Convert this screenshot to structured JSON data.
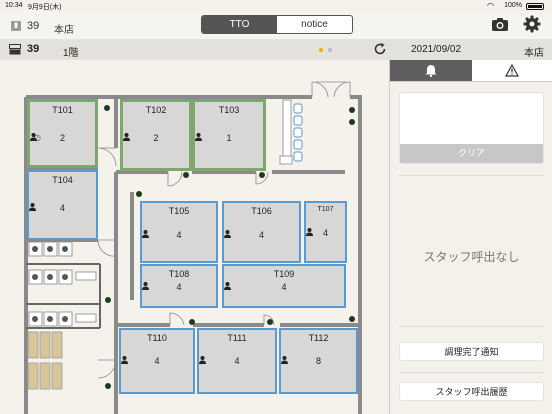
{
  "status": {
    "time": "10:34",
    "date": "9月9日(木)",
    "battery": "100%"
  },
  "header": {
    "badge": "39",
    "store": "本店",
    "tabs": [
      {
        "label": "TTO"
      },
      {
        "label": "notice"
      }
    ]
  },
  "subheader": {
    "register_count": "39",
    "floor": "1階",
    "date": "2021/09/02",
    "store": "本店"
  },
  "tables": [
    {
      "id": "T101",
      "count": "2"
    },
    {
      "id": "T102",
      "count": "2"
    },
    {
      "id": "T103",
      "count": "1"
    },
    {
      "id": "T104",
      "count": "4"
    },
    {
      "id": "T105",
      "count": "4"
    },
    {
      "id": "T106",
      "count": "4"
    },
    {
      "id": "T107",
      "count": "4"
    },
    {
      "id": "T108",
      "count": "4"
    },
    {
      "id": "T109",
      "count": "4"
    },
    {
      "id": "T110",
      "count": "4"
    },
    {
      "id": "T111",
      "count": "4"
    },
    {
      "id": "T112",
      "count": "8"
    }
  ],
  "panel": {
    "clear_label": "クリア",
    "empty_message": "スタッフ呼出なし",
    "cooking_done_label": "調理完了通知",
    "call_history_label": "スタッフ呼出履歴"
  },
  "icons": [
    "bell-icon",
    "warning-icon",
    "camera-icon",
    "gear-icon",
    "refresh-icon",
    "register-icon",
    "person-icon",
    "plant-icon"
  ],
  "colors": {
    "table_border_blue": "#5b9ad1",
    "table_border_green": "#7ea66f",
    "table_fill": "#d7d7d6",
    "dot_active": "#e8b400"
  }
}
